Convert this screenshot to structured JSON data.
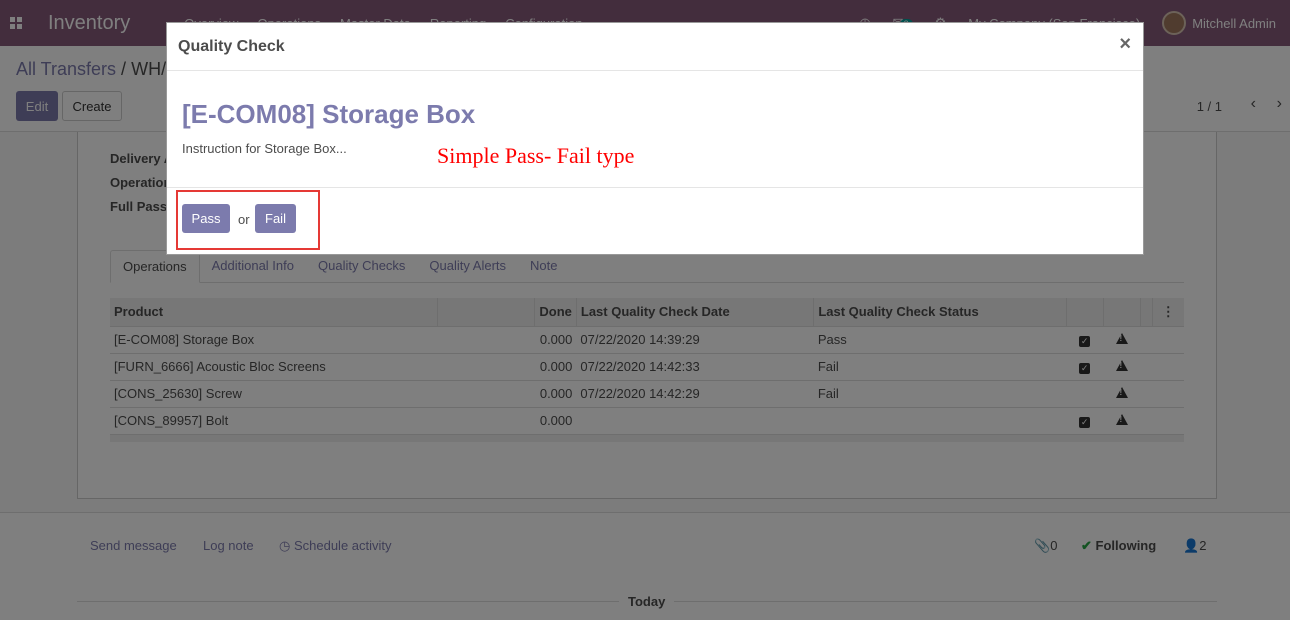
{
  "navbar": {
    "app_name": "Inventory",
    "menu": [
      "Overview",
      "Operations",
      "Master Data",
      "Reporting",
      "Configuration"
    ],
    "message_count": "3",
    "company": "My Company (San Francisco)",
    "user": "Mitchell Admin"
  },
  "control": {
    "breadcrumb_root": "All Transfers",
    "breadcrumb_sep": "/",
    "breadcrumb_current": "WH/",
    "edit_label": "Edit",
    "create_label": "Create",
    "pager": "1 / 1"
  },
  "form": {
    "fields": [
      "Delivery A",
      "Operation",
      "Full Pass"
    ],
    "tabs": [
      "Operations",
      "Additional Info",
      "Quality Checks",
      "Quality Alerts",
      "Note"
    ],
    "table": {
      "headers": [
        "Product",
        "",
        "Done",
        "Last Quality Check Date",
        "Last Quality Check Status"
      ],
      "rows": [
        {
          "product": "[E-COM08] Storage Box",
          "done": "0.000",
          "date": "07/22/2020 14:39:29",
          "status": "Pass",
          "checked": true
        },
        {
          "product": "[FURN_6666] Acoustic Bloc Screens",
          "done": "0.000",
          "date": "07/22/2020 14:42:33",
          "status": "Fail",
          "checked": true
        },
        {
          "product": "[CONS_25630] Screw",
          "done": "0.000",
          "date": "07/22/2020 14:42:29",
          "status": "Fail",
          "checked": false
        },
        {
          "product": "[CONS_89957] Bolt",
          "done": "0.000",
          "date": "",
          "status": "",
          "checked": true
        }
      ]
    }
  },
  "chatter": {
    "send_message": "Send message",
    "log_note": "Log note",
    "schedule_activity": "Schedule activity",
    "attachments": "0",
    "following": "Following",
    "followers": "2",
    "today": "Today"
  },
  "modal": {
    "title": "Quality Check",
    "close": "×",
    "product": "[E-COM08] Storage Box",
    "instruction": "Instruction for Storage Box...",
    "annotation": "Simple Pass- Fail type",
    "pass_label": "Pass",
    "or_label": "or",
    "fail_label": "Fail"
  },
  "colors": {
    "brand": "#875a7b",
    "accent": "#7c7bad",
    "annotation": "#ff0000"
  }
}
